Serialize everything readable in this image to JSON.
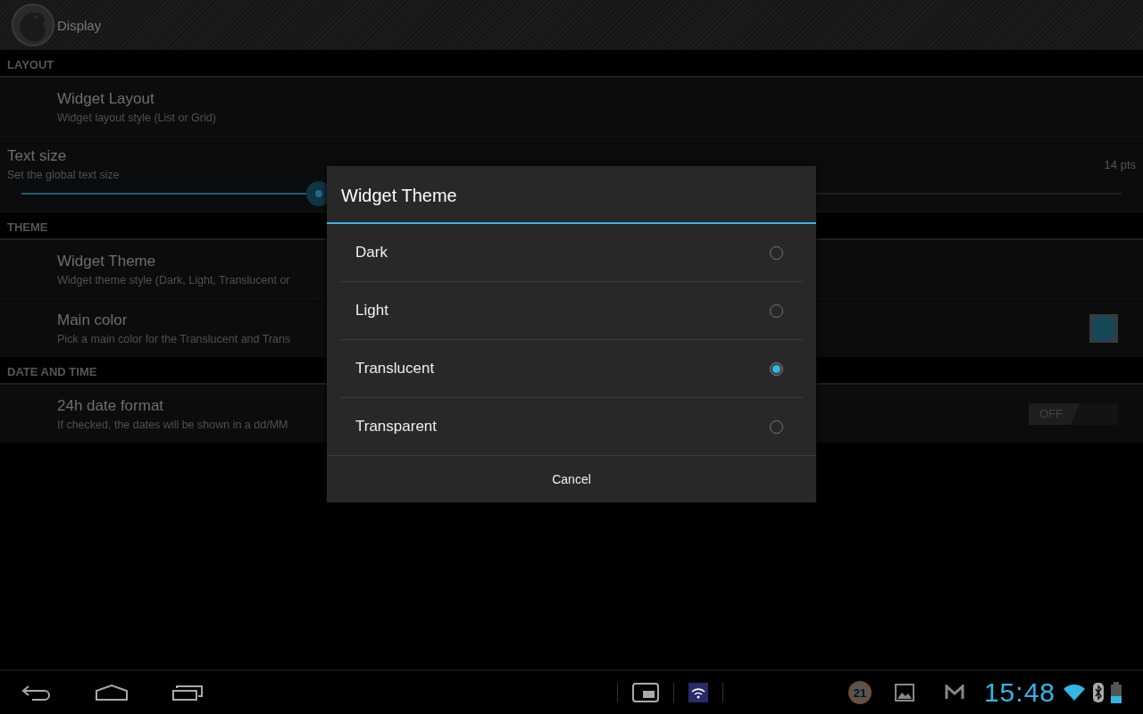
{
  "app_bar": {
    "title": "Display"
  },
  "sections": [
    {
      "header": "LAYOUT",
      "items": [
        {
          "kind": "plain",
          "title": "Widget Layout",
          "summary": "Widget layout style (List or Grid)"
        },
        {
          "kind": "slider",
          "title": "Text size",
          "summary": "Set the global text size",
          "value": "14 pts",
          "level": 0.27
        }
      ]
    },
    {
      "header": "THEME",
      "items": [
        {
          "kind": "plain",
          "title": "Widget Theme",
          "summary": "Widget theme style (Dark, Light, Translucent or"
        },
        {
          "kind": "color",
          "title": "Main color",
          "summary": "Pick a main color for the Translucent and Trans",
          "color": "#164858"
        }
      ]
    },
    {
      "header": "DATE AND TIME",
      "items": [
        {
          "kind": "switch",
          "title": "24h date format",
          "summary": "If checked, the dates will be shown in a dd/MM",
          "on": false,
          "switch_label": "OFF"
        }
      ]
    }
  ],
  "dialog": {
    "title": "Widget Theme",
    "options": [
      {
        "label": "Dark",
        "selected": false
      },
      {
        "label": "Light",
        "selected": false
      },
      {
        "label": "Translucent",
        "selected": true
      },
      {
        "label": "Transparent",
        "selected": false
      }
    ],
    "button": "Cancel"
  },
  "navigation_bar": {
    "notification_count": "21",
    "time": "15:48"
  }
}
